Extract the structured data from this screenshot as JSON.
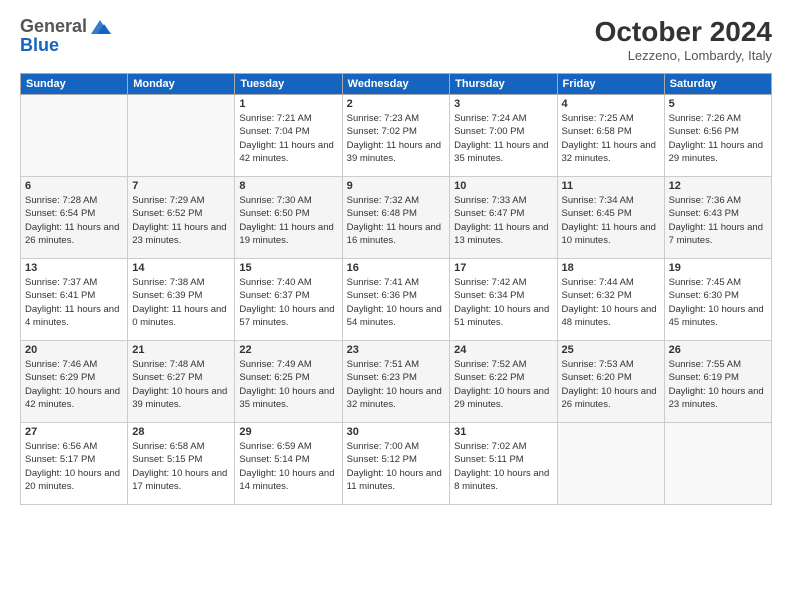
{
  "logo": {
    "general": "General",
    "blue": "Blue"
  },
  "title": "October 2024",
  "location": "Lezzeno, Lombardy, Italy",
  "headers": [
    "Sunday",
    "Monday",
    "Tuesday",
    "Wednesday",
    "Thursday",
    "Friday",
    "Saturday"
  ],
  "weeks": [
    [
      {
        "day": "",
        "detail": ""
      },
      {
        "day": "",
        "detail": ""
      },
      {
        "day": "1",
        "detail": "Sunrise: 7:21 AM\nSunset: 7:04 PM\nDaylight: 11 hours and 42 minutes."
      },
      {
        "day": "2",
        "detail": "Sunrise: 7:23 AM\nSunset: 7:02 PM\nDaylight: 11 hours and 39 minutes."
      },
      {
        "day": "3",
        "detail": "Sunrise: 7:24 AM\nSunset: 7:00 PM\nDaylight: 11 hours and 35 minutes."
      },
      {
        "day": "4",
        "detail": "Sunrise: 7:25 AM\nSunset: 6:58 PM\nDaylight: 11 hours and 32 minutes."
      },
      {
        "day": "5",
        "detail": "Sunrise: 7:26 AM\nSunset: 6:56 PM\nDaylight: 11 hours and 29 minutes."
      }
    ],
    [
      {
        "day": "6",
        "detail": "Sunrise: 7:28 AM\nSunset: 6:54 PM\nDaylight: 11 hours and 26 minutes."
      },
      {
        "day": "7",
        "detail": "Sunrise: 7:29 AM\nSunset: 6:52 PM\nDaylight: 11 hours and 23 minutes."
      },
      {
        "day": "8",
        "detail": "Sunrise: 7:30 AM\nSunset: 6:50 PM\nDaylight: 11 hours and 19 minutes."
      },
      {
        "day": "9",
        "detail": "Sunrise: 7:32 AM\nSunset: 6:48 PM\nDaylight: 11 hours and 16 minutes."
      },
      {
        "day": "10",
        "detail": "Sunrise: 7:33 AM\nSunset: 6:47 PM\nDaylight: 11 hours and 13 minutes."
      },
      {
        "day": "11",
        "detail": "Sunrise: 7:34 AM\nSunset: 6:45 PM\nDaylight: 11 hours and 10 minutes."
      },
      {
        "day": "12",
        "detail": "Sunrise: 7:36 AM\nSunset: 6:43 PM\nDaylight: 11 hours and 7 minutes."
      }
    ],
    [
      {
        "day": "13",
        "detail": "Sunrise: 7:37 AM\nSunset: 6:41 PM\nDaylight: 11 hours and 4 minutes."
      },
      {
        "day": "14",
        "detail": "Sunrise: 7:38 AM\nSunset: 6:39 PM\nDaylight: 11 hours and 0 minutes."
      },
      {
        "day": "15",
        "detail": "Sunrise: 7:40 AM\nSunset: 6:37 PM\nDaylight: 10 hours and 57 minutes."
      },
      {
        "day": "16",
        "detail": "Sunrise: 7:41 AM\nSunset: 6:36 PM\nDaylight: 10 hours and 54 minutes."
      },
      {
        "day": "17",
        "detail": "Sunrise: 7:42 AM\nSunset: 6:34 PM\nDaylight: 10 hours and 51 minutes."
      },
      {
        "day": "18",
        "detail": "Sunrise: 7:44 AM\nSunset: 6:32 PM\nDaylight: 10 hours and 48 minutes."
      },
      {
        "day": "19",
        "detail": "Sunrise: 7:45 AM\nSunset: 6:30 PM\nDaylight: 10 hours and 45 minutes."
      }
    ],
    [
      {
        "day": "20",
        "detail": "Sunrise: 7:46 AM\nSunset: 6:29 PM\nDaylight: 10 hours and 42 minutes."
      },
      {
        "day": "21",
        "detail": "Sunrise: 7:48 AM\nSunset: 6:27 PM\nDaylight: 10 hours and 39 minutes."
      },
      {
        "day": "22",
        "detail": "Sunrise: 7:49 AM\nSunset: 6:25 PM\nDaylight: 10 hours and 35 minutes."
      },
      {
        "day": "23",
        "detail": "Sunrise: 7:51 AM\nSunset: 6:23 PM\nDaylight: 10 hours and 32 minutes."
      },
      {
        "day": "24",
        "detail": "Sunrise: 7:52 AM\nSunset: 6:22 PM\nDaylight: 10 hours and 29 minutes."
      },
      {
        "day": "25",
        "detail": "Sunrise: 7:53 AM\nSunset: 6:20 PM\nDaylight: 10 hours and 26 minutes."
      },
      {
        "day": "26",
        "detail": "Sunrise: 7:55 AM\nSunset: 6:19 PM\nDaylight: 10 hours and 23 minutes."
      }
    ],
    [
      {
        "day": "27",
        "detail": "Sunrise: 6:56 AM\nSunset: 5:17 PM\nDaylight: 10 hours and 20 minutes."
      },
      {
        "day": "28",
        "detail": "Sunrise: 6:58 AM\nSunset: 5:15 PM\nDaylight: 10 hours and 17 minutes."
      },
      {
        "day": "29",
        "detail": "Sunrise: 6:59 AM\nSunset: 5:14 PM\nDaylight: 10 hours and 14 minutes."
      },
      {
        "day": "30",
        "detail": "Sunrise: 7:00 AM\nSunset: 5:12 PM\nDaylight: 10 hours and 11 minutes."
      },
      {
        "day": "31",
        "detail": "Sunrise: 7:02 AM\nSunset: 5:11 PM\nDaylight: 10 hours and 8 minutes."
      },
      {
        "day": "",
        "detail": ""
      },
      {
        "day": "",
        "detail": ""
      }
    ]
  ]
}
